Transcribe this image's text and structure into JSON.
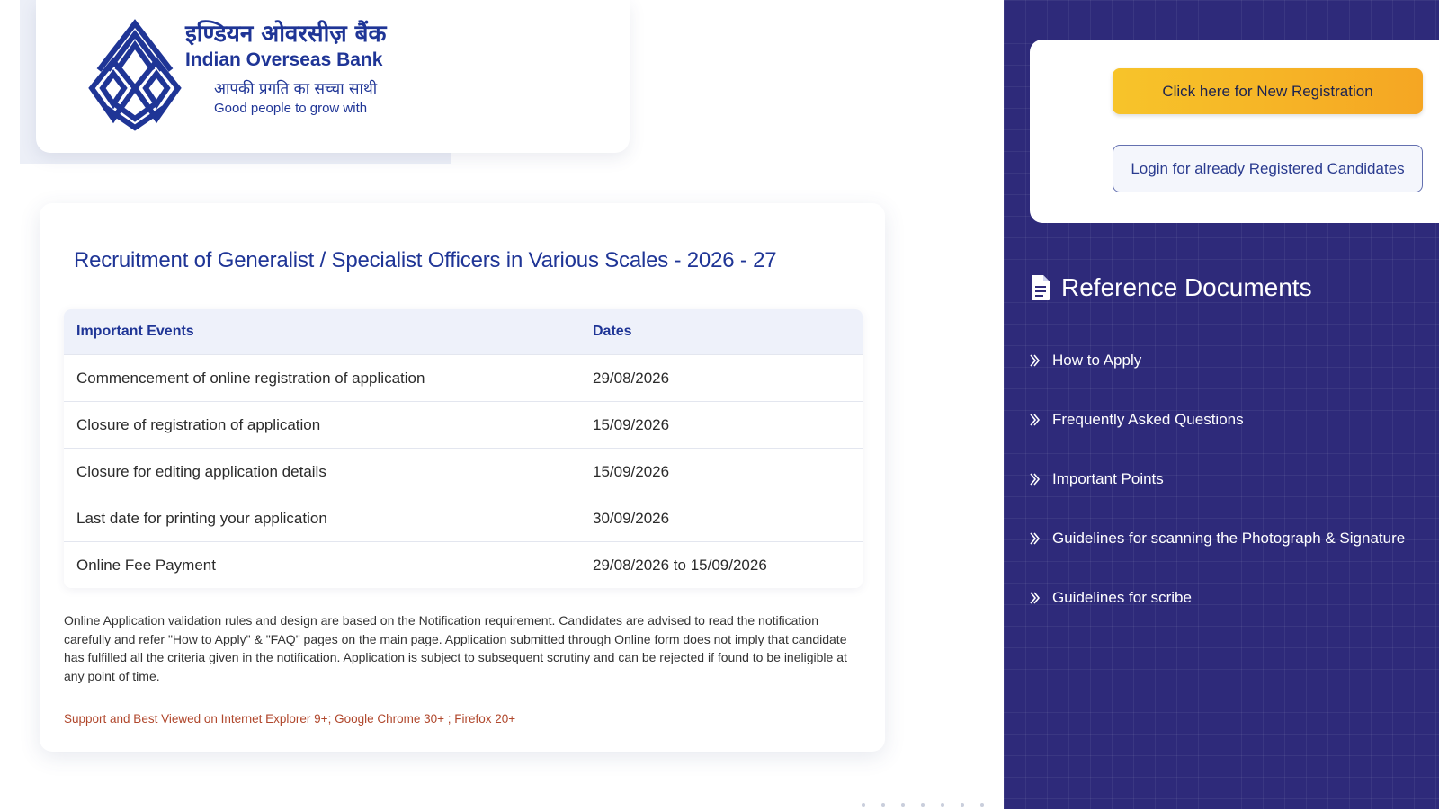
{
  "header": {
    "bank_name_hindi": "इण्डियन ओवरसीज़ बैंक",
    "bank_name_english": "Indian Overseas Bank",
    "tagline_hindi": "आपकी प्रगति का सच्चा साथी",
    "tagline_english": "Good people to grow with"
  },
  "main": {
    "title": "Recruitment of Generalist / Specialist Officers in Various Scales - 2026 - 27",
    "table": {
      "columns": [
        "Important Events",
        "Dates"
      ],
      "rows": [
        {
          "event": "Commencement of online registration of application",
          "date": "29/08/2026"
        },
        {
          "event": "Closure of registration of application",
          "date": "15/09/2026"
        },
        {
          "event": "Closure for editing application details",
          "date": "15/09/2026"
        },
        {
          "event": "Last date for printing your application",
          "date": "30/09/2026"
        },
        {
          "event": "Online Fee Payment",
          "date": "29/08/2026 to 15/09/2026"
        }
      ]
    },
    "disclaimer": "Online Application validation rules and design are based on the Notification requirement. Candidates are advised to read the notification carefully and refer \"How to Apply\" & \"FAQ\" pages on the main page. Application submitted through Online form does not imply that candidate has fulfilled all the criteria given in the notification. Application is subject to subsequent scrutiny and can be rejected if found to be ineligible at any point of time.",
    "support_note": "Support and Best Viewed on Internet Explorer 9+; Google Chrome 30+ ; Firefox 20+"
  },
  "sidebar": {
    "new_registration_label": "Click here for New Registration",
    "login_label": "Login for already Registered Candidates",
    "reference_title": "Reference Documents",
    "documents": [
      {
        "label": "How to Apply"
      },
      {
        "label": "Frequently Asked Questions"
      },
      {
        "label": "Important Points"
      },
      {
        "label": "Guidelines for scanning the Photograph & Signature"
      },
      {
        "label": "Guidelines for scribe"
      }
    ]
  },
  "icons": {
    "logo": "iob-logo-icon",
    "document": "document-icon",
    "list_marker": "double-chevron-right-icon"
  },
  "colors": {
    "brand_blue": "#1f3596",
    "panel_bg": "#2e2a7a",
    "cta_yellow": "#f7c42a",
    "cta_orange": "#f5a623",
    "support_text": "#b0472c"
  }
}
